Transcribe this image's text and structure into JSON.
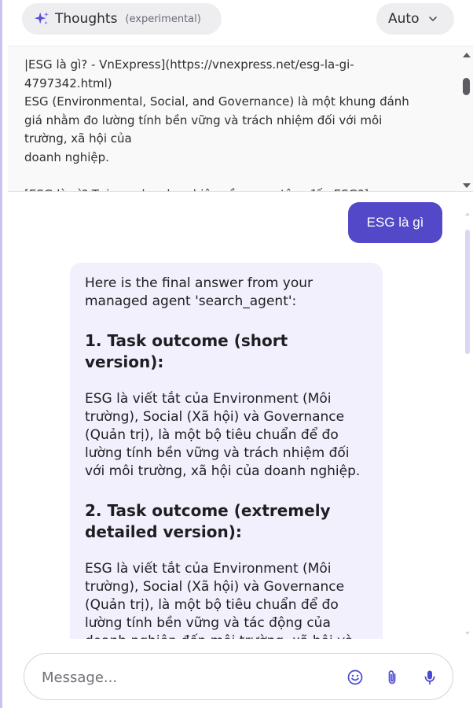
{
  "header": {
    "thoughts_label": "Thoughts",
    "thoughts_tag": "(experimental)",
    "model_select": "Auto",
    "icons": [
      "sparkle-icon",
      "chevron-down-icon"
    ]
  },
  "thoughts": {
    "lines": [
      "|ESG là gì? - VnExpress](https://vnexpress.net/esg-la-gi-",
      "4797342.html)",
      "ESG (Environmental, Social, and Governance) là một khung đánh",
      "giá nhằm đo lường tính bền vững và trách nhiệm đối với môi",
      "trường, xã hội của",
      "doanh nghiệp."
    ],
    "cut_line": "[ESG là gì? Tại sao doanh nghiệp cần quan tâm đến ESG?]"
  },
  "chat": {
    "user_message": "ESG là gì",
    "agent": {
      "intro": "Here is the final answer from your managed agent 'search_agent':",
      "heading1": "1. Task outcome (short version):",
      "para1": "ESG là viết tắt của Environment (Môi trường), Social (Xã hội) và Governance (Quản trị), là một bộ tiêu chuẩn để đo lường tính bền vững và trách nhiệm đối với môi trường, xã hội của doanh nghiệp.",
      "heading2": "2. Task outcome (extremely detailed version):",
      "para2": "ESG là viết tắt của Environment (Môi trường), Social (Xã hội) và Governance (Quản trị), là một bộ tiêu chuẩn để đo lường tính bền vững và tác động của doanh nghiệp đến môi trường, xã hội và"
    }
  },
  "composer": {
    "placeholder": "Message...",
    "icons": [
      "emoji-icon",
      "paperclip-icon",
      "microphone-icon"
    ]
  },
  "colors": {
    "accent": "#5348c8",
    "agent_bubble": "#f1f0fc",
    "pill_bg": "#eeeef1"
  }
}
